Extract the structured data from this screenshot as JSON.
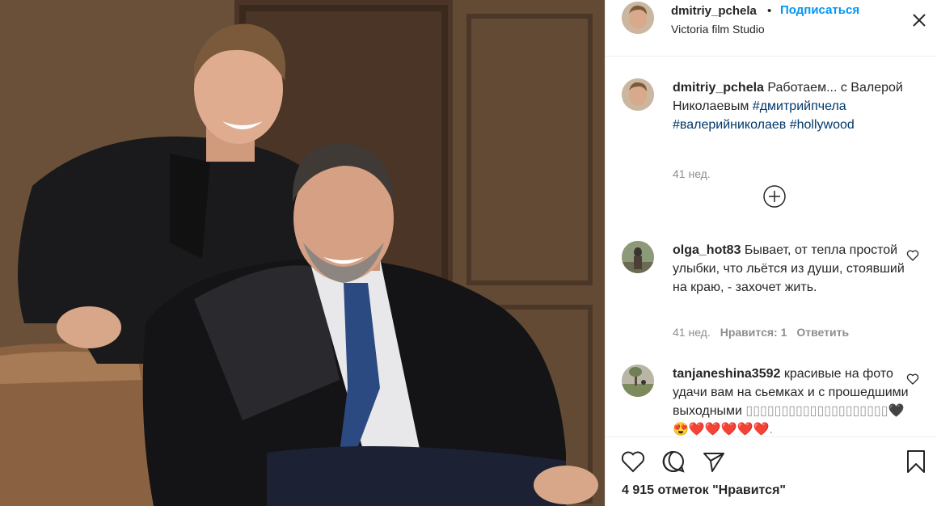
{
  "colors": {
    "follow": "#0095f6",
    "hashtag": "#00376b",
    "meta": "#8e8e8e",
    "text": "#262626"
  },
  "header": {
    "username": "dmitriy_pchela",
    "separator": "•",
    "follow_label": "Подписаться",
    "location": "Victoria film Studio",
    "more_icon": "more-icon"
  },
  "caption": {
    "username": "dmitriy_pchela",
    "text": " Работаем... с Валерой Николаевым ",
    "hashtags": [
      "#дмитрийпчела",
      "#валерийниколаев",
      "#hollywood"
    ],
    "time": "41 нед."
  },
  "load_more_icon": "plus-circle-icon",
  "comments": [
    {
      "username": "olga_hot83",
      "text": " Бывает, от тепла простой улыбки, что льётся из души, стоявший на краю, - захочет жить.",
      "time": "41 нед.",
      "likes": "Нравится: 1",
      "reply": "Ответить"
    },
    {
      "username": "tanjaneshina3592",
      "text": " красивые на фото удачи вам на сьемках и с прошедшими выходными ",
      "glyphs": "▯▯▯▯▯▯▯▯▯▯▯▯▯▯▯▯▯▯▯▯🖤😍❤️❤️❤️❤️❤️.",
      "time": "",
      "likes": "",
      "reply": ""
    }
  ],
  "actions": {
    "like_icon": "heart-icon",
    "comment_icon": "comment-icon",
    "share_icon": "share-icon",
    "save_icon": "bookmark-icon",
    "likes_text": "4 915 отметок \"Нравится\""
  }
}
